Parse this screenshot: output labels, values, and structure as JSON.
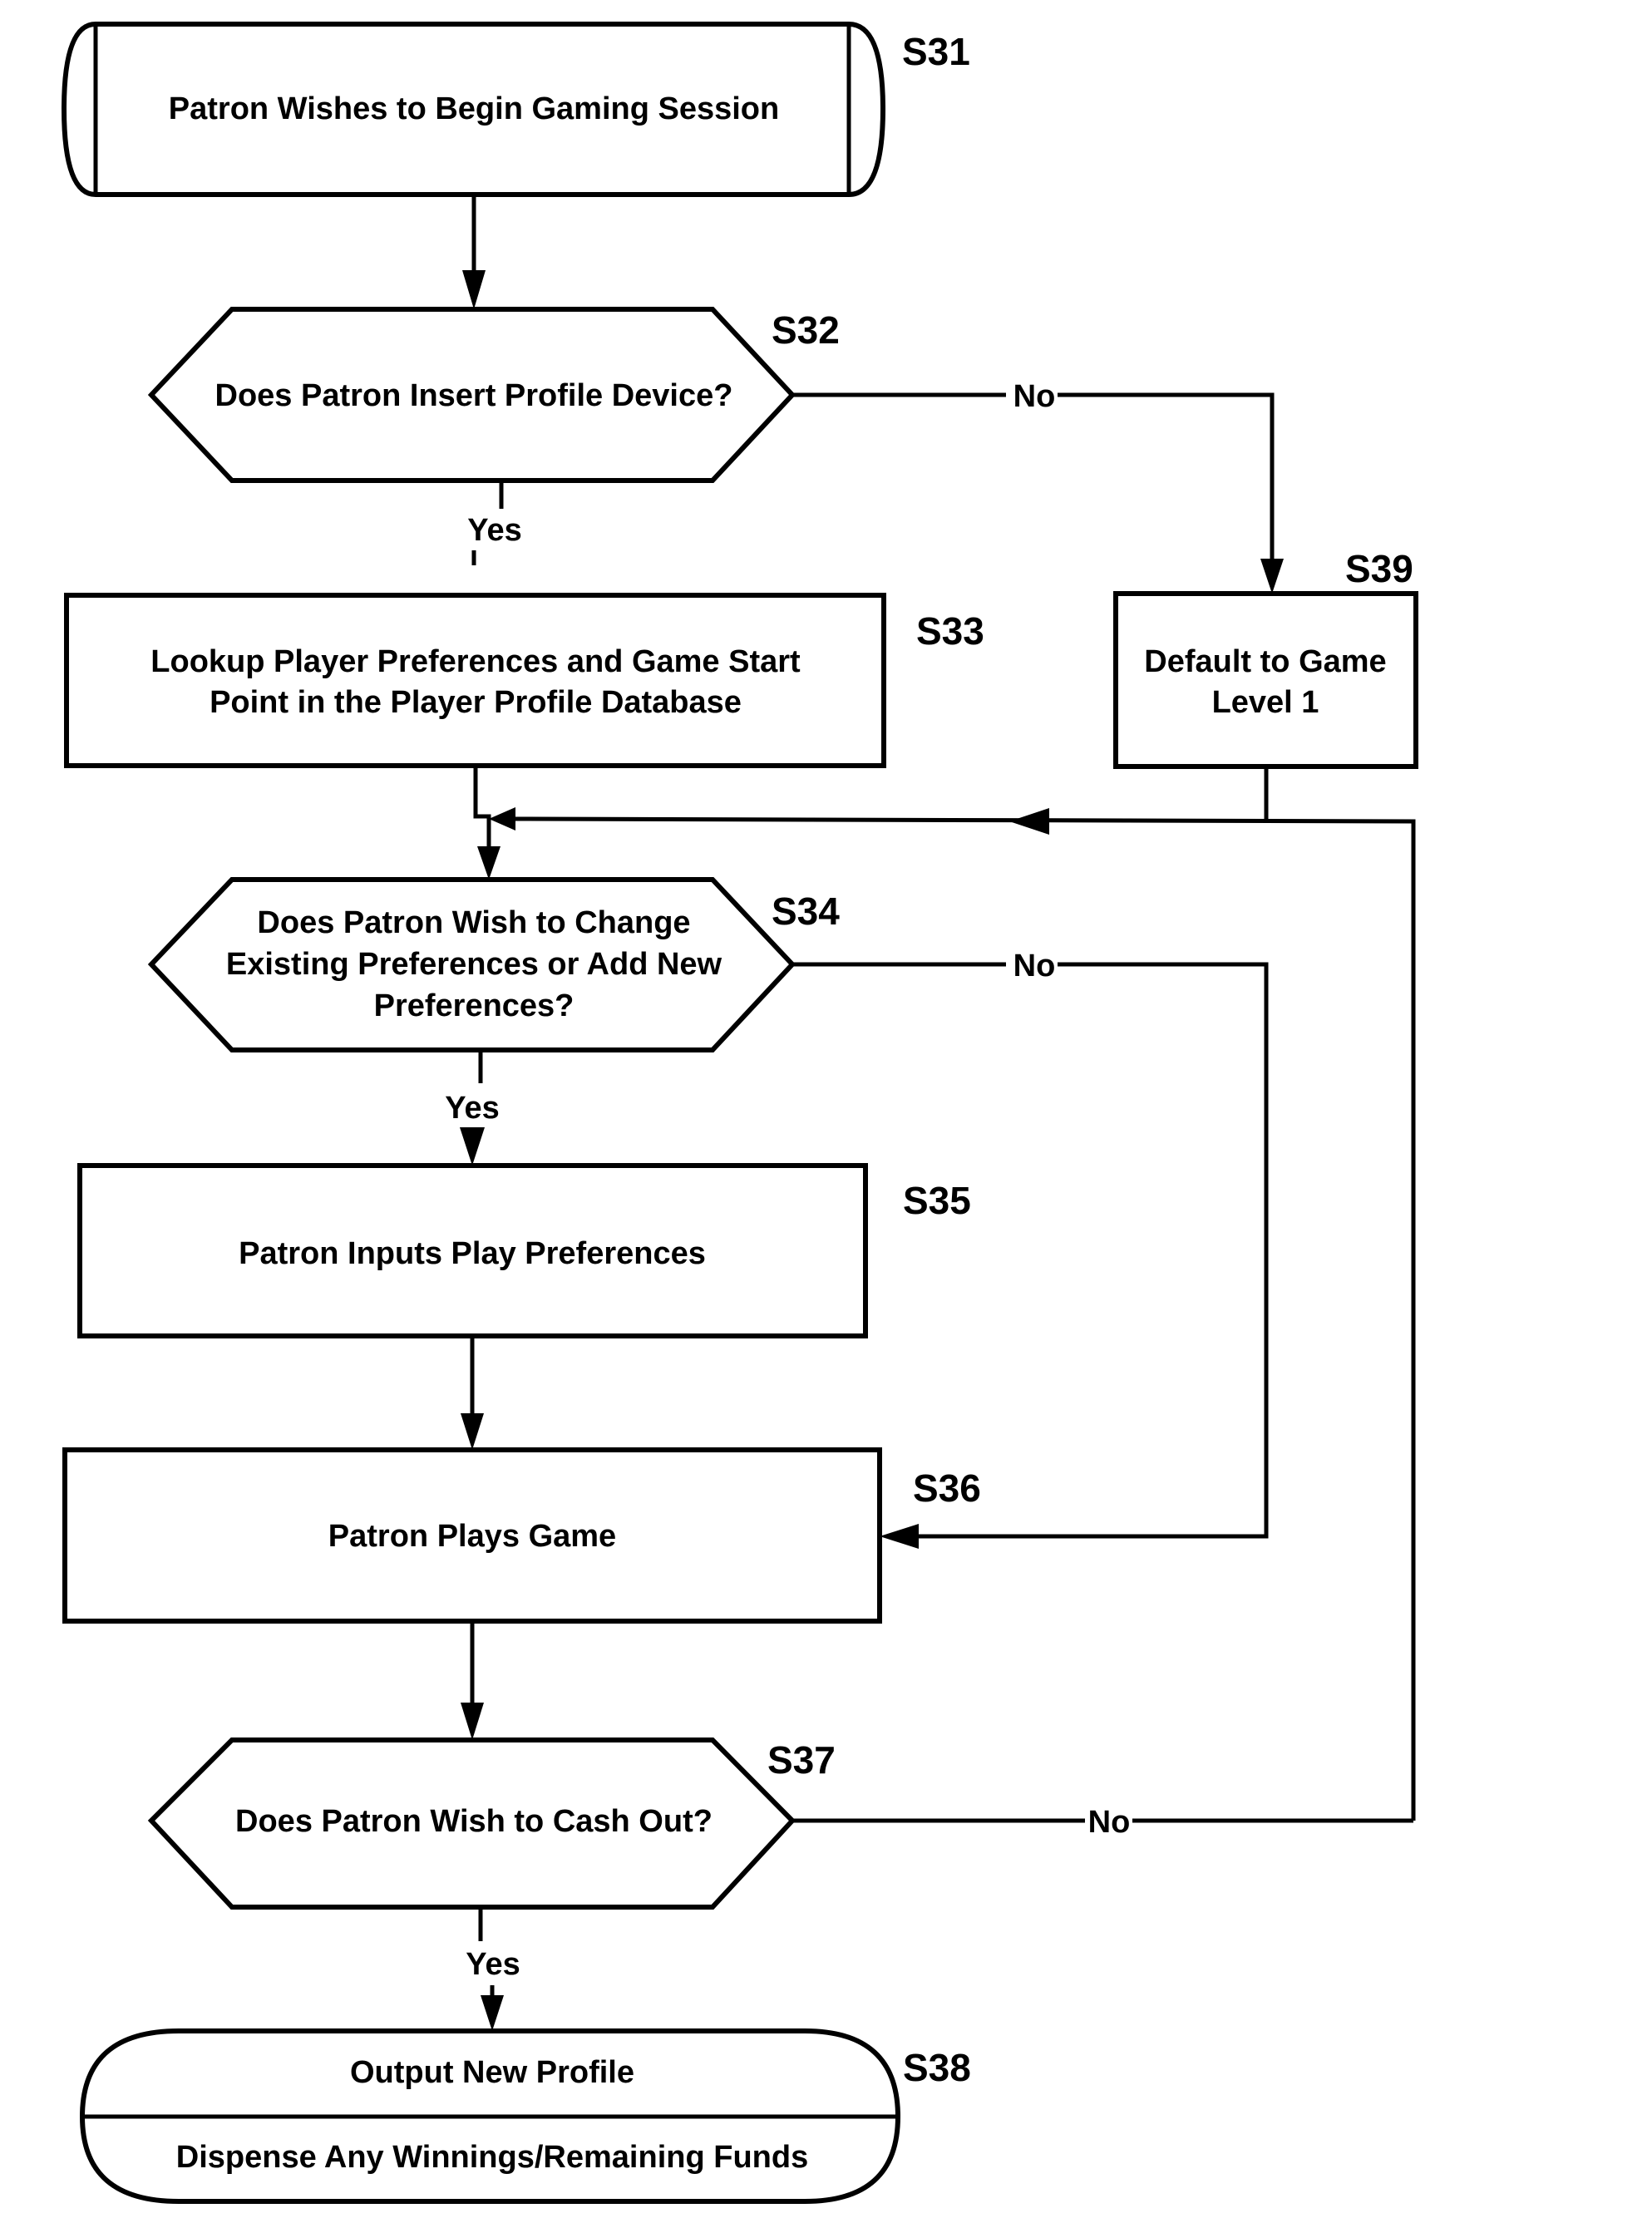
{
  "nodes": {
    "s31": {
      "id": "S31",
      "lines": [
        "Patron Wishes to Begin Gaming Session"
      ]
    },
    "s32": {
      "id": "S32",
      "lines": [
        "Does Patron Insert Profile Device?"
      ]
    },
    "s33": {
      "id": "S33",
      "lines": [
        "Lookup Player Preferences and Game Start",
        "Point in the Player Profile Database"
      ]
    },
    "s34": {
      "id": "S34",
      "lines": [
        "Does Patron Wish to Change",
        "Existing Preferences or Add New",
        "Preferences?"
      ]
    },
    "s35": {
      "id": "S35",
      "lines": [
        "Patron Inputs Play Preferences"
      ]
    },
    "s36": {
      "id": "S36",
      "lines": [
        "Patron Plays Game"
      ]
    },
    "s37": {
      "id": "S37",
      "lines": [
        "Does Patron Wish to Cash Out?"
      ]
    },
    "s38": {
      "id": "S38",
      "lines": [
        "Output New Profile",
        "Dispense Any Winnings/Remaining Funds"
      ]
    },
    "s39": {
      "id": "S39",
      "lines": [
        "Default to Game",
        "Level 1"
      ]
    }
  },
  "edges": {
    "s32_yes": "Yes",
    "s32_no": "No",
    "s34_yes": "Yes",
    "s34_no": "No",
    "s37_yes": "Yes",
    "s37_no": "No"
  }
}
